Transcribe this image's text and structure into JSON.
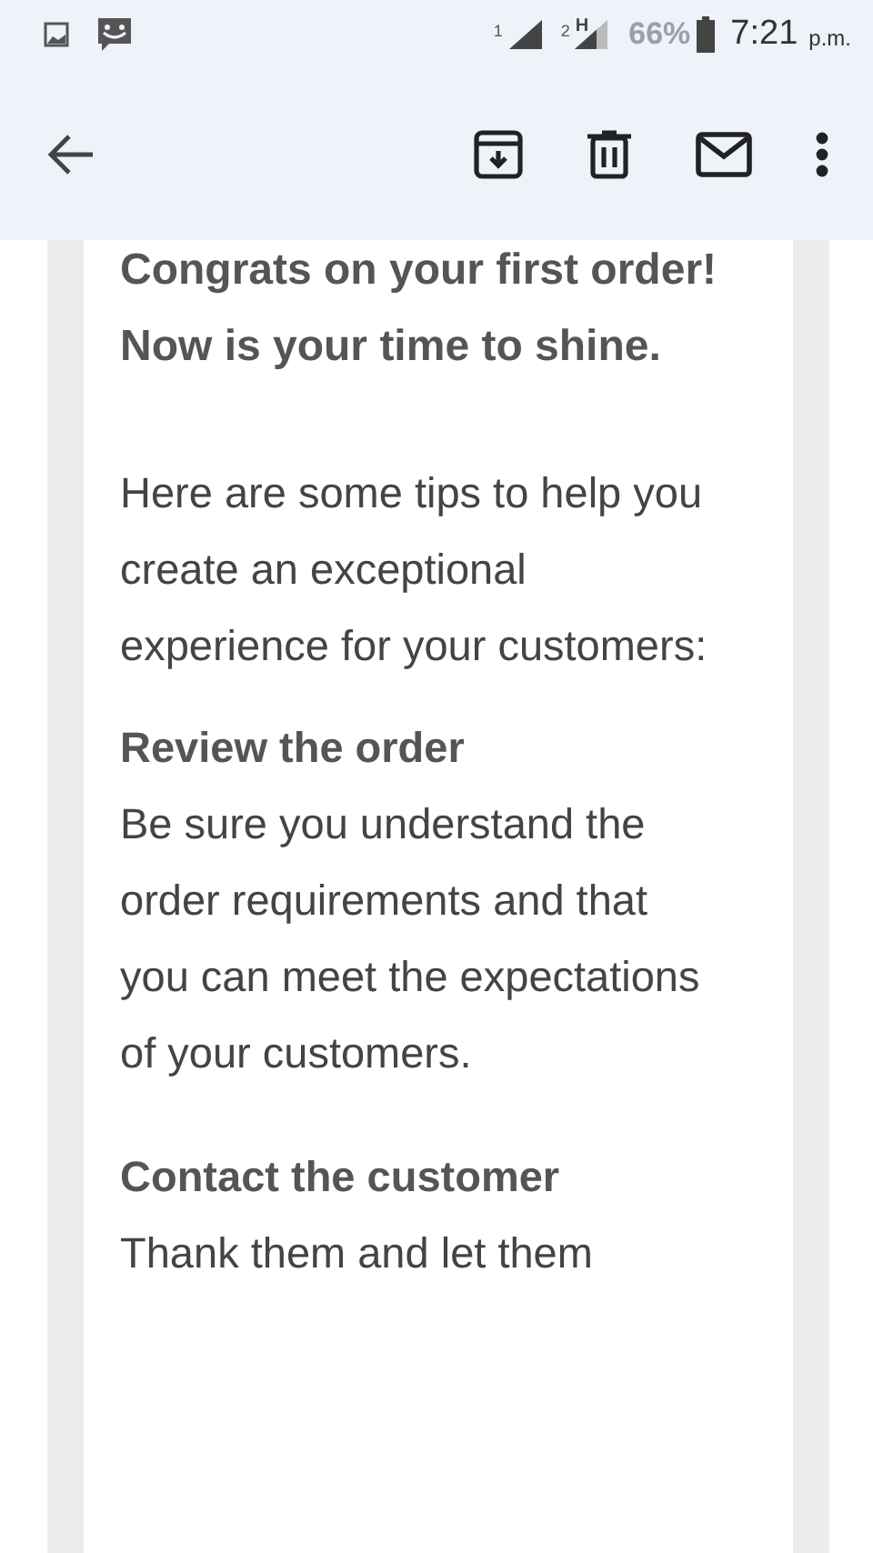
{
  "status_bar": {
    "sim_1": "1",
    "sim_2": "2",
    "network_type": "H",
    "battery": "66%",
    "time": "7:21",
    "period": "p.m."
  },
  "email": {
    "heading": "Congrats on your first order! Now is your time to shine.",
    "intro": "Here are some tips to help you create an exceptional experience for your customers:",
    "sections": [
      {
        "title": "Review the order",
        "body": "Be sure you understand the order requirements and that you can meet the expectations of your customers."
      },
      {
        "title": "Contact the customer",
        "body": "Thank them and let them"
      }
    ]
  }
}
